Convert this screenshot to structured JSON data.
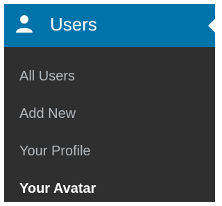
{
  "menu": {
    "title": "Users",
    "icon": "user-icon",
    "colors": {
      "header_background": "#0073aa",
      "submenu_background": "#2f2f2f",
      "item_text": "#b4b9be",
      "current_item_text": "#ffffff"
    },
    "items": [
      {
        "label": "All Users"
      },
      {
        "label": "Add New"
      },
      {
        "label": "Your Profile"
      },
      {
        "label": "Your Avatar",
        "current": true
      }
    ]
  }
}
